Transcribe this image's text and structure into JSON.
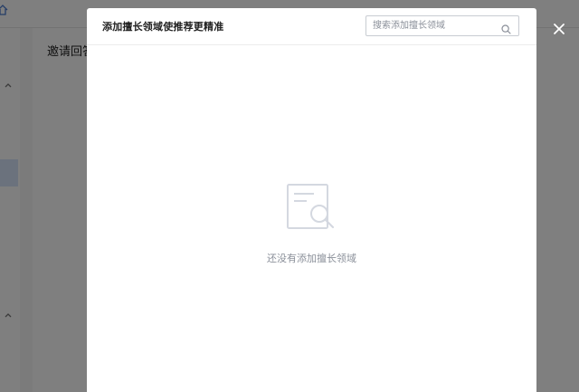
{
  "background_page": {
    "heading": "邀请回答",
    "home_icon": "home-icon",
    "chevron_icon": "chevron-up-icon"
  },
  "modal": {
    "title": "添加擅长领域使推荐更精准",
    "search": {
      "placeholder": "搜索添加擅长领域",
      "value": "",
      "icon": "search-icon"
    },
    "empty_state": {
      "icon": "empty-document-search-icon",
      "text": "还没有添加擅长领域"
    },
    "close_icon": "close-icon"
  },
  "colors": {
    "overlay": "#00000080",
    "empty_text": "#8a8f99",
    "illustration": "#d4d8e0"
  }
}
